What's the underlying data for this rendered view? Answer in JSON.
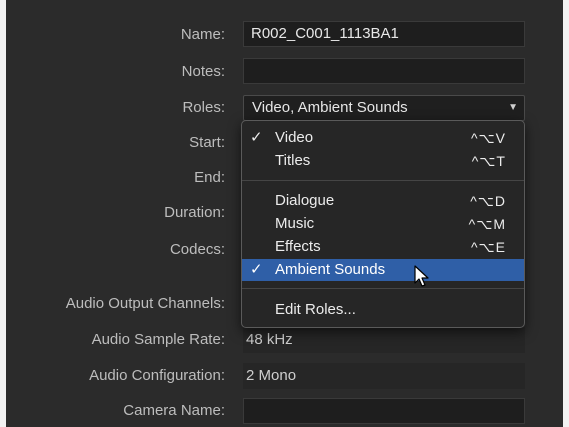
{
  "inspector": {
    "name": {
      "label": "Name:",
      "value": "R002_C001_1113BA1"
    },
    "notes": {
      "label": "Notes:",
      "value": ""
    },
    "roles": {
      "label": "Roles:",
      "value": "Video, Ambient Sounds"
    },
    "start": {
      "label": "Start:"
    },
    "end": {
      "label": "End:"
    },
    "duration": {
      "label": "Duration:"
    },
    "codecs": {
      "label": "Codecs:"
    },
    "audio_output_channels": {
      "label": "Audio Output Channels:"
    },
    "audio_sample_rate": {
      "label": "Audio Sample Rate:",
      "value": "48 kHz"
    },
    "audio_configuration": {
      "label": "Audio Configuration:",
      "value": "2 Mono"
    },
    "camera_name": {
      "label": "Camera Name:",
      "value": ""
    }
  },
  "roles_menu": {
    "items": [
      {
        "check": "✓",
        "label": "Video",
        "shortcut": "^⌥V"
      },
      {
        "check": "",
        "label": "Titles",
        "shortcut": "^⌥T"
      },
      {
        "check": "",
        "label": "Dialogue",
        "shortcut": "^⌥D"
      },
      {
        "check": "",
        "label": "Music",
        "shortcut": "^⌥M"
      },
      {
        "check": "",
        "label": "Effects",
        "shortcut": "^⌥E"
      },
      {
        "check": "✓",
        "label": "Ambient Sounds",
        "shortcut": ""
      },
      {
        "check": "",
        "label": "Edit Roles...",
        "shortcut": ""
      }
    ],
    "selected_color": "#2f5fa7"
  },
  "icons": {
    "popup": "chevron-down-icon",
    "cursor": "mouse-pointer-icon"
  }
}
